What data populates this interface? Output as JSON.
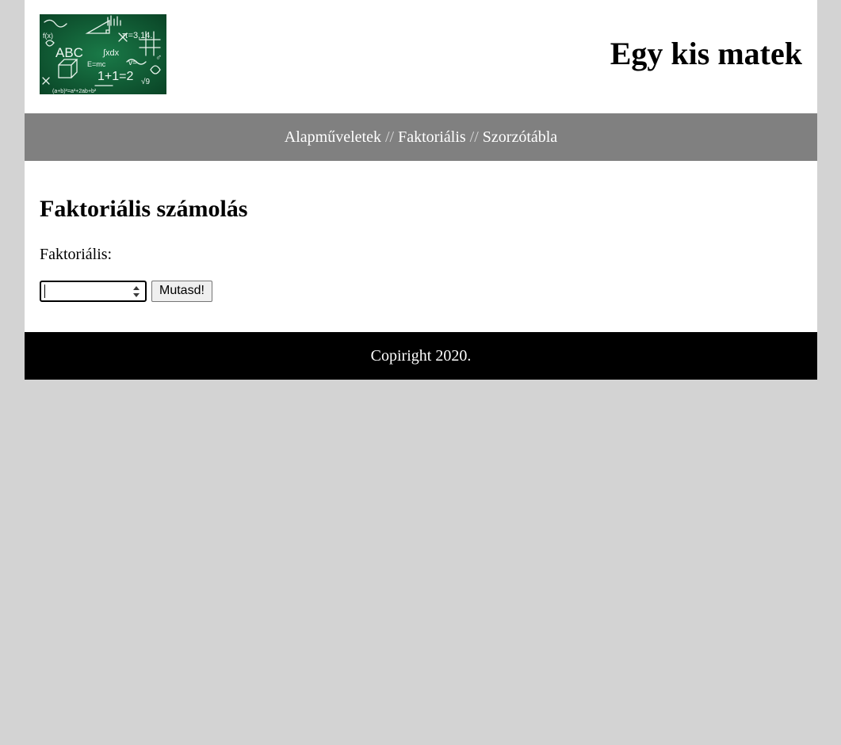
{
  "header": {
    "logo_icon": "math-chalkboard-logo",
    "title": "Egy kis matek"
  },
  "nav": {
    "items": [
      {
        "label": "Alapműveletek"
      },
      {
        "label": "Faktoriális"
      },
      {
        "label": "Szorzótábla"
      }
    ],
    "separator": "//"
  },
  "main": {
    "heading": "Faktoriális számolás",
    "field_label": "Faktoriális:",
    "input_value": "",
    "button_label": "Mutasd!"
  },
  "footer": {
    "text": "Copiright 2020."
  },
  "colors": {
    "background": "#d3d3d3",
    "nav_background": "#808080",
    "footer_background": "#000000",
    "logo_board": "#0f5a33"
  }
}
